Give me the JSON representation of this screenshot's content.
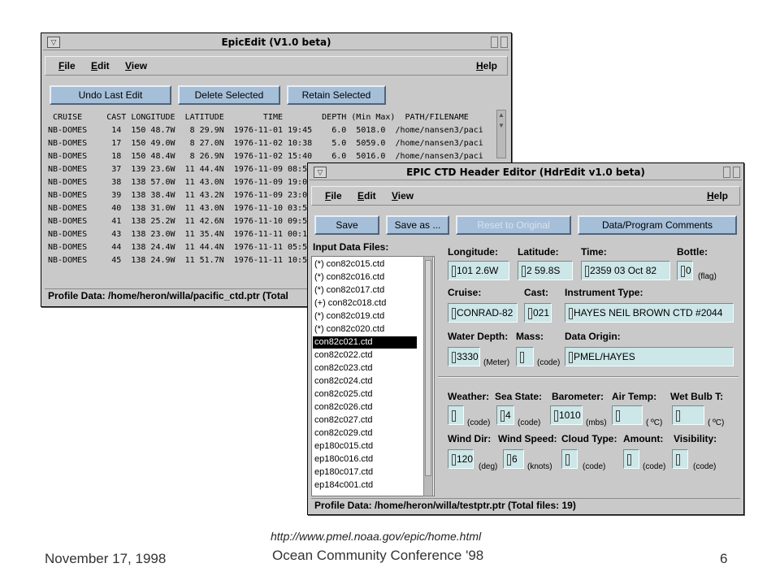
{
  "epicedit": {
    "title": "EpicEdit (V1.0 beta)",
    "menus": [
      "File",
      "Edit",
      "View"
    ],
    "help": "Help",
    "buttons": [
      "Undo Last Edit",
      "Delete Selected",
      "Retain Selected"
    ],
    "header": " CRUISE     CAST LONGITUDE  LATITUDE        TIME        DEPTH (Min Max)  PATH/FILENAME",
    "rows": [
      "NB-DOMES     14  150 48.7W   8 29.9N  1976-11-01 19:45    6.0  5018.0  /home/nansen3/paci",
      "NB-DOMES     17  150 49.0W   8 27.0N  1976-11-02 10:38    5.0  5059.0  /home/nansen3/paci",
      "NB-DOMES     18  150 48.4W   8 26.9N  1976-11-02 15:40    6.0  5016.0  /home/nansen3/paci",
      "NB-DOMES     37  139 23.6W  11 44.4N  1976-11-09 08:5",
      "NB-DOMES     38  138 57.0W  11 43.0N  1976-11-09 19:0",
      "NB-DOMES     39  138 38.4W  11 43.2N  1976-11-09 23:0",
      "NB-DOMES     40  138 31.0W  11 43.0N  1976-11-10 03:5",
      "NB-DOMES     41  138 25.2W  11 42.6N  1976-11-10 09:5",
      "NB-DOMES     43  138 23.0W  11 35.4N  1976-11-11 00:1",
      "NB-DOMES     44  138 24.4W  11 44.4N  1976-11-11 05:5",
      "NB-DOMES     45  138 24.9W  11 51.7N  1976-11-11 10:5"
    ],
    "status": "Profile Data: /home/heron/willa/pacific_ctd.ptr  (Total"
  },
  "hdredit": {
    "title": "EPIC CTD Header Editor (HdrEdit  v1.0 beta)",
    "menus": [
      "File",
      "Edit",
      "View"
    ],
    "help": "Help",
    "buttons": {
      "save": "Save",
      "save_as": "Save as ...",
      "reset": "Reset to Original",
      "comments": "Data/Program Comments"
    },
    "input_files_label": "Input Data Files:",
    "files": [
      "(*) con82c015.ctd",
      "(*) con82c016.ctd",
      "(*) con82c017.ctd",
      "(+) con82c018.ctd",
      "(*) con82c019.ctd",
      "(*) con82c020.ctd",
      "con82c021.ctd",
      "con82c022.ctd",
      "con82c023.ctd",
      "con82c024.ctd",
      "con82c025.ctd",
      "con82c026.ctd",
      "con82c027.ctd",
      "con82c029.ctd",
      "ep180c015.ctd",
      "ep180c016.ctd",
      "ep180c017.ctd",
      "ep184c001.ctd"
    ],
    "selected_file_index": 6,
    "labels": {
      "longitude": "Longitude:",
      "latitude": "Latitude:",
      "time": "Time:",
      "bottle": "Bottle:",
      "cruise": "Cruise:",
      "cast": "Cast:",
      "instrument": "Instrument Type:",
      "water_depth": "Water Depth:",
      "mass": "Mass:",
      "origin": "Data Origin:",
      "weather": "Weather:",
      "sea_state": "Sea State:",
      "barometer": "Barometer:",
      "air_temp": "Air Temp:",
      "wet_bulb": "Wet Bulb T:",
      "wind_dir": "Wind Dir:",
      "wind_speed": "Wind Speed:",
      "cloud_type": "Cloud Type:",
      "amount": "Amount:",
      "visibility": "Visibility:"
    },
    "values": {
      "longitude": "101  2.6W",
      "latitude": "2 59.8S",
      "time": "2359 03 Oct 82",
      "bottle": "0",
      "cruise": "CONRAD-82",
      "cast": "021",
      "instrument": "HAYES NEIL BROWN CTD #2044",
      "water_depth": "3330",
      "mass": "",
      "origin": "PMEL/HAYES",
      "weather": "",
      "sea_state": "4",
      "barometer": "1010",
      "air_temp": "",
      "wet_bulb": "",
      "wind_dir": "120",
      "wind_speed": "6",
      "cloud_type": "",
      "amount": "",
      "visibility": ""
    },
    "units": {
      "flag": "(flag)",
      "meter": "(Meter)",
      "code": "(code)",
      "mbs": "(mbs)",
      "degc": "( ºC)",
      "deg": "(deg)",
      "knots": "(knots)"
    },
    "status": "Profile Data: /home/heron/willa/testptr.ptr  (Total files: 19)"
  },
  "footer": {
    "url": "http://www.pmel.noaa.gov/epic/home.html",
    "date": "November 17, 1998",
    "conference": "Ocean Community Conference '98",
    "page": "6"
  }
}
